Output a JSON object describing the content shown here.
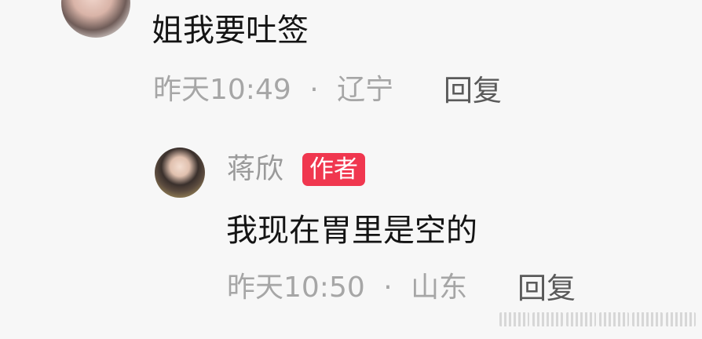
{
  "comment": {
    "text": "姐我要吐签",
    "time": "昨天10:49",
    "separator": "·",
    "location": "辽宁",
    "reply_label": "回复"
  },
  "reply": {
    "author_name": "蒋欣",
    "author_badge": "作者",
    "text": "我现在胃里是空的",
    "time": "昨天10:50",
    "separator": "·",
    "location": "山东",
    "reply_label": "回复"
  },
  "colors": {
    "background": "#f7f7f7",
    "badge": "#f0374f",
    "meta_text": "#a6a6a6"
  }
}
